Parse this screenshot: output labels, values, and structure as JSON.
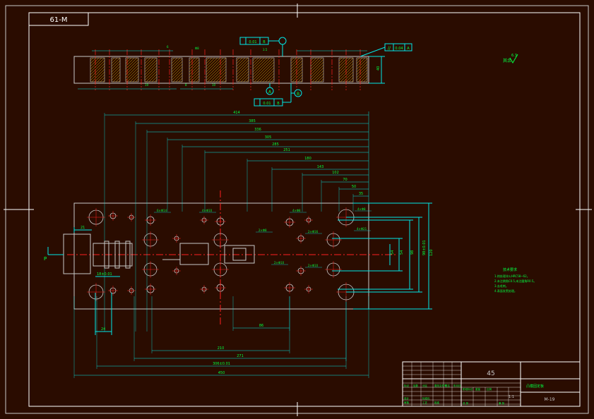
{
  "drawing_no": "61-M",
  "material": "45",
  "part_name": "凸模固定板",
  "scale": "1:1",
  "sheet_code": "M-19",
  "roughness_label": "其余",
  "roughness_value": "6.3",
  "flatness_frame": [
    "//",
    "0.04",
    "A"
  ],
  "tol_frame_top": [
    "0.01",
    "B"
  ],
  "tol_frame_bottom": [
    "0.01",
    "B"
  ],
  "datum_a": "A",
  "datum_b": "B",
  "notes_title": "技术要求",
  "notes": [
    "1.热处理淬火HRC58~62。",
    "2.未注倒角C0.5,未注圆角R0.5。",
    "3.去毛刺。",
    "4.表面发黑处理。"
  ],
  "h_dims": [
    "414",
    "385",
    "336",
    "305",
    "285",
    "251",
    "180",
    "143",
    "102",
    "70",
    "50",
    "35"
  ],
  "bottom_dims": [
    "86",
    "210",
    "271",
    "306±0.01",
    "450"
  ],
  "left_dims": [
    "21",
    "24",
    "18±0.01"
  ],
  "right_dims": [
    "120",
    "98±0.01",
    "98",
    "54",
    "54"
  ],
  "hole_callouts": [
    "6×Φ14",
    "4×Φ10",
    "4×Φ8",
    "2×Φ8",
    "2×Φ16",
    "4×Φ21",
    "2×Φ10",
    "2×Φ10",
    "4×Φ8"
  ],
  "section_dims": [
    "19",
    "8",
    "Φ8",
    "6",
    "10",
    "3.5"
  ],
  "side_dim": "40",
  "title_block_labels": [
    "标记",
    "处数",
    "分区",
    "更改文件号",
    "签名",
    "年月日",
    "设计",
    "标准化",
    "审核",
    "工艺",
    "批准",
    "阶段标记",
    "重量",
    "比例",
    "共 张",
    "第 张"
  ],
  "view_label_p": "P",
  "colors": {
    "background": "#2a0c00",
    "frame": "#ffffff",
    "outline": "#c8c8c8",
    "dimension": "#00e8e8",
    "center": "#ff2020",
    "hatch": "#e0b000",
    "text": "#00ff40",
    "border": "#00e8e8"
  }
}
